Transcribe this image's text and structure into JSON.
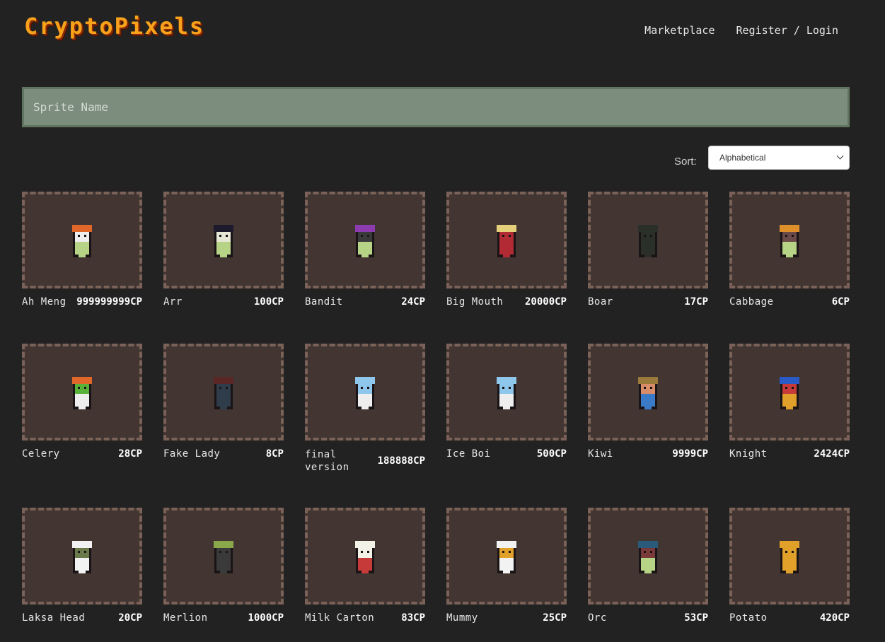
{
  "brand": {
    "logo": "CryptoPixels"
  },
  "nav": {
    "marketplace": "Marketplace",
    "auth": "Register / Login"
  },
  "search": {
    "placeholder": "Sprite Name"
  },
  "sort": {
    "label": "Sort:",
    "selected": "Alphabetical"
  },
  "sprites": [
    {
      "name": "Ah Meng",
      "price": "999999999CP",
      "icon": "orange-haired-sprite",
      "hair": "#e0662a",
      "face": "#eeeeee",
      "body": "#b7d486"
    },
    {
      "name": "Arr",
      "price": "100CP",
      "icon": "pirate-sprite",
      "hair": "#1d1a2e",
      "face": "#e8e8d6",
      "body": "#b7d486"
    },
    {
      "name": "Bandit",
      "price": "24CP",
      "icon": "bandit-sprite",
      "hair": "#8c3cae",
      "face": "#3a3a3a",
      "body": "#b7d486"
    },
    {
      "name": "Big Mouth",
      "price": "20000CP",
      "icon": "big-mouth-sprite",
      "hair": "#e6cf7a",
      "face": "#b22a34",
      "body": "#b22a34"
    },
    {
      "name": "Boar",
      "price": "17CP",
      "icon": "boar-sprite",
      "hair": "#2a2f2a",
      "face": "#2a2f2a",
      "body": "#2a2f2a"
    },
    {
      "name": "Cabbage",
      "price": "6CP",
      "icon": "cabbage-sprite",
      "hair": "#e0902a",
      "face": "#6b4a4a",
      "body": "#b7d486"
    },
    {
      "name": "Celery",
      "price": "28CP",
      "icon": "celery-sprite",
      "hair": "#e0662a",
      "face": "#58b23a",
      "body": "#eeeeee"
    },
    {
      "name": "Fake Lady",
      "price": "8CP",
      "icon": "fake-lady-sprite",
      "hair": "#5a2626",
      "face": "#2f3c4a",
      "body": "#2f3c4a"
    },
    {
      "name": "final version",
      "price": "188888CP",
      "icon": "blue-block-sprite",
      "hair": "#8ec6ec",
      "face": "#8ec6ec",
      "body": "#eeeeee"
    },
    {
      "name": "Ice Boi",
      "price": "500CP",
      "icon": "ice-boi-sprite",
      "hair": "#8ec6ec",
      "face": "#8ec6ec",
      "body": "#eeeeee"
    },
    {
      "name": "Kiwi",
      "price": "9999CP",
      "icon": "kiwi-sprite",
      "hair": "#9a7a3a",
      "face": "#d88c6a",
      "body": "#3a7ac6"
    },
    {
      "name": "Knight",
      "price": "2424CP",
      "icon": "knight-sprite",
      "hair": "#2a5ac6",
      "face": "#c63a3a",
      "body": "#e0a02a"
    },
    {
      "name": "Laksa Head",
      "price": "20CP",
      "icon": "laksa-head-sprite",
      "hair": "#f2f2f2",
      "face": "#6a7a4a",
      "body": "#f2f2f2"
    },
    {
      "name": "Merlion",
      "price": "1000CP",
      "icon": "merlion-sprite",
      "hair": "#8aa84a",
      "face": "#3a3a3a",
      "body": "#3a3a3a"
    },
    {
      "name": "Milk Carton",
      "price": "83CP",
      "icon": "milk-carton-sprite",
      "hair": "#f2f2e6",
      "face": "#f2f2e6",
      "body": "#c63a3a"
    },
    {
      "name": "Mummy",
      "price": "25CP",
      "icon": "mummy-sprite",
      "hair": "#f2f2f2",
      "face": "#e0a02a",
      "body": "#f2f2f2"
    },
    {
      "name": "Orc",
      "price": "53CP",
      "icon": "orc-sprite",
      "hair": "#2a5a7a",
      "face": "#7a3a3a",
      "body": "#b7d486"
    },
    {
      "name": "Potato",
      "price": "420CP",
      "icon": "potato-sprite",
      "hair": "#e0a02a",
      "face": "#e0a02a",
      "body": "#e0a02a"
    }
  ]
}
